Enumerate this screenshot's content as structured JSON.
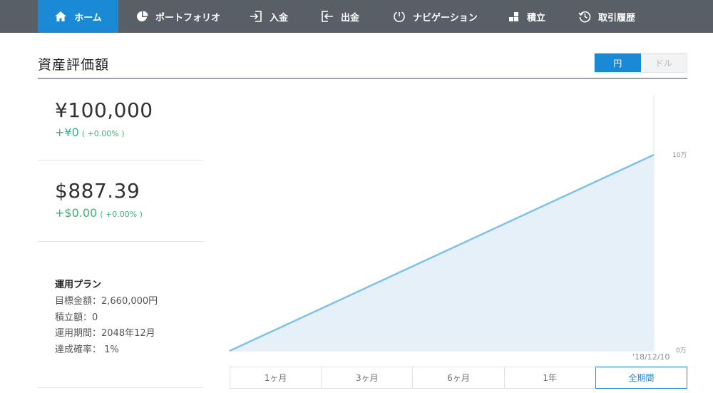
{
  "nav": {
    "items": [
      {
        "label": "ホーム",
        "icon": "home-icon"
      },
      {
        "label": "ポートフォリオ",
        "icon": "pie-chart-icon"
      },
      {
        "label": "入金",
        "icon": "deposit-icon"
      },
      {
        "label": "出金",
        "icon": "withdraw-icon"
      },
      {
        "label": "ナビゲーション",
        "icon": "navigation-icon"
      },
      {
        "label": "積立",
        "icon": "accumulate-icon"
      },
      {
        "label": "取引履歴",
        "icon": "history-icon"
      }
    ],
    "active": "ホーム"
  },
  "header": {
    "title": "資産評価額",
    "currency_toggle": {
      "yen": "円",
      "dollar": "ドル",
      "selected": "円"
    }
  },
  "summary": {
    "yen": {
      "amount": "¥100,000",
      "change": "+¥0",
      "change_pct": "( +0.00% )"
    },
    "usd": {
      "amount": "$887.39",
      "change": "+$0.00",
      "change_pct": "( +0.00% )"
    }
  },
  "plan": {
    "title": "運用プラン",
    "lines": [
      "目標金額：2,660,000円",
      "積立額：0",
      "運用期間：2048年12月",
      "達成確率： 1%"
    ]
  },
  "chart_data": {
    "type": "area",
    "y_ticks": [
      "10万",
      "0万"
    ],
    "ylim": [
      0,
      100000
    ],
    "x_label": "'18/12/10",
    "series": [
      {
        "values": [
          0,
          100000
        ]
      }
    ],
    "colors": {
      "line": "#7fc1e8",
      "fill": "#e6f0f8"
    }
  },
  "periods": {
    "options": [
      "1ヶ月",
      "3ヶ月",
      "6ヶ月",
      "1年",
      "全期間"
    ],
    "selected": "全期間"
  },
  "colors": {
    "accent": "#1a8ad6",
    "nav_bg": "#595f66",
    "positive": "#3bb27a"
  }
}
